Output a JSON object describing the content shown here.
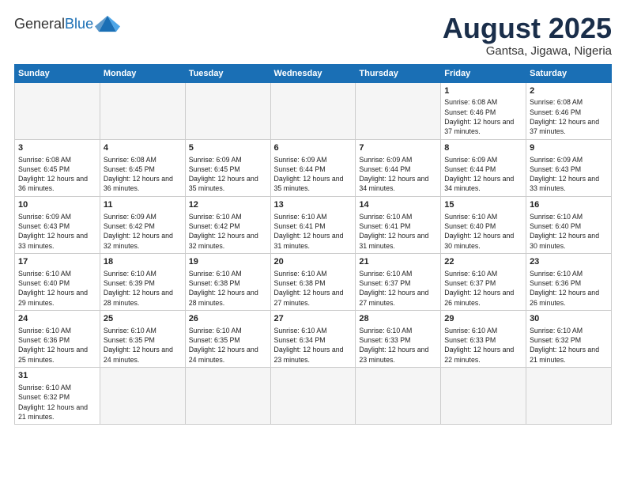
{
  "header": {
    "logo_general": "General",
    "logo_blue": "Blue",
    "title": "August 2025",
    "subtitle": "Gantsa, Jigawa, Nigeria"
  },
  "weekdays": [
    "Sunday",
    "Monday",
    "Tuesday",
    "Wednesday",
    "Thursday",
    "Friday",
    "Saturday"
  ],
  "weeks": [
    [
      {
        "day": "",
        "info": "",
        "empty": true
      },
      {
        "day": "",
        "info": "",
        "empty": true
      },
      {
        "day": "",
        "info": "",
        "empty": true
      },
      {
        "day": "",
        "info": "",
        "empty": true
      },
      {
        "day": "",
        "info": "",
        "empty": true
      },
      {
        "day": "1",
        "info": "Sunrise: 6:08 AM\nSunset: 6:46 PM\nDaylight: 12 hours\nand 37 minutes."
      },
      {
        "day": "2",
        "info": "Sunrise: 6:08 AM\nSunset: 6:46 PM\nDaylight: 12 hours\nand 37 minutes."
      }
    ],
    [
      {
        "day": "3",
        "info": "Sunrise: 6:08 AM\nSunset: 6:45 PM\nDaylight: 12 hours\nand 36 minutes."
      },
      {
        "day": "4",
        "info": "Sunrise: 6:08 AM\nSunset: 6:45 PM\nDaylight: 12 hours\nand 36 minutes."
      },
      {
        "day": "5",
        "info": "Sunrise: 6:09 AM\nSunset: 6:45 PM\nDaylight: 12 hours\nand 35 minutes."
      },
      {
        "day": "6",
        "info": "Sunrise: 6:09 AM\nSunset: 6:44 PM\nDaylight: 12 hours\nand 35 minutes."
      },
      {
        "day": "7",
        "info": "Sunrise: 6:09 AM\nSunset: 6:44 PM\nDaylight: 12 hours\nand 34 minutes."
      },
      {
        "day": "8",
        "info": "Sunrise: 6:09 AM\nSunset: 6:44 PM\nDaylight: 12 hours\nand 34 minutes."
      },
      {
        "day": "9",
        "info": "Sunrise: 6:09 AM\nSunset: 6:43 PM\nDaylight: 12 hours\nand 33 minutes."
      }
    ],
    [
      {
        "day": "10",
        "info": "Sunrise: 6:09 AM\nSunset: 6:43 PM\nDaylight: 12 hours\nand 33 minutes."
      },
      {
        "day": "11",
        "info": "Sunrise: 6:09 AM\nSunset: 6:42 PM\nDaylight: 12 hours\nand 32 minutes."
      },
      {
        "day": "12",
        "info": "Sunrise: 6:10 AM\nSunset: 6:42 PM\nDaylight: 12 hours\nand 32 minutes."
      },
      {
        "day": "13",
        "info": "Sunrise: 6:10 AM\nSunset: 6:41 PM\nDaylight: 12 hours\nand 31 minutes."
      },
      {
        "day": "14",
        "info": "Sunrise: 6:10 AM\nSunset: 6:41 PM\nDaylight: 12 hours\nand 31 minutes."
      },
      {
        "day": "15",
        "info": "Sunrise: 6:10 AM\nSunset: 6:40 PM\nDaylight: 12 hours\nand 30 minutes."
      },
      {
        "day": "16",
        "info": "Sunrise: 6:10 AM\nSunset: 6:40 PM\nDaylight: 12 hours\nand 30 minutes."
      }
    ],
    [
      {
        "day": "17",
        "info": "Sunrise: 6:10 AM\nSunset: 6:40 PM\nDaylight: 12 hours\nand 29 minutes."
      },
      {
        "day": "18",
        "info": "Sunrise: 6:10 AM\nSunset: 6:39 PM\nDaylight: 12 hours\nand 28 minutes."
      },
      {
        "day": "19",
        "info": "Sunrise: 6:10 AM\nSunset: 6:38 PM\nDaylight: 12 hours\nand 28 minutes."
      },
      {
        "day": "20",
        "info": "Sunrise: 6:10 AM\nSunset: 6:38 PM\nDaylight: 12 hours\nand 27 minutes."
      },
      {
        "day": "21",
        "info": "Sunrise: 6:10 AM\nSunset: 6:37 PM\nDaylight: 12 hours\nand 27 minutes."
      },
      {
        "day": "22",
        "info": "Sunrise: 6:10 AM\nSunset: 6:37 PM\nDaylight: 12 hours\nand 26 minutes."
      },
      {
        "day": "23",
        "info": "Sunrise: 6:10 AM\nSunset: 6:36 PM\nDaylight: 12 hours\nand 26 minutes."
      }
    ],
    [
      {
        "day": "24",
        "info": "Sunrise: 6:10 AM\nSunset: 6:36 PM\nDaylight: 12 hours\nand 25 minutes."
      },
      {
        "day": "25",
        "info": "Sunrise: 6:10 AM\nSunset: 6:35 PM\nDaylight: 12 hours\nand 24 minutes."
      },
      {
        "day": "26",
        "info": "Sunrise: 6:10 AM\nSunset: 6:35 PM\nDaylight: 12 hours\nand 24 minutes."
      },
      {
        "day": "27",
        "info": "Sunrise: 6:10 AM\nSunset: 6:34 PM\nDaylight: 12 hours\nand 23 minutes."
      },
      {
        "day": "28",
        "info": "Sunrise: 6:10 AM\nSunset: 6:33 PM\nDaylight: 12 hours\nand 23 minutes."
      },
      {
        "day": "29",
        "info": "Sunrise: 6:10 AM\nSunset: 6:33 PM\nDaylight: 12 hours\nand 22 minutes."
      },
      {
        "day": "30",
        "info": "Sunrise: 6:10 AM\nSunset: 6:32 PM\nDaylight: 12 hours\nand 21 minutes."
      }
    ],
    [
      {
        "day": "31",
        "info": "Sunrise: 6:10 AM\nSunset: 6:32 PM\nDaylight: 12 hours\nand 21 minutes.",
        "last": true
      },
      {
        "day": "",
        "info": "",
        "empty": true,
        "last": true
      },
      {
        "day": "",
        "info": "",
        "empty": true,
        "last": true
      },
      {
        "day": "",
        "info": "",
        "empty": true,
        "last": true
      },
      {
        "day": "",
        "info": "",
        "empty": true,
        "last": true
      },
      {
        "day": "",
        "info": "",
        "empty": true,
        "last": true
      },
      {
        "day": "",
        "info": "",
        "empty": true,
        "last": true
      }
    ]
  ]
}
